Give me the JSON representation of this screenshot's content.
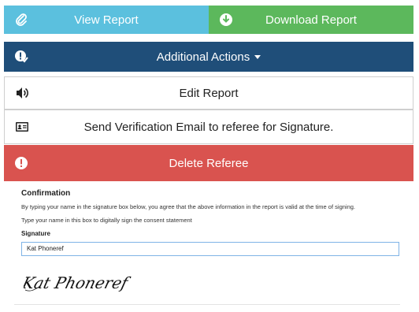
{
  "actions": {
    "view_report": "View Report",
    "download_report": "Download Report",
    "additional_actions": "Additional Actions",
    "edit_report": "Edit Report",
    "send_verification": "Send Verification Email to referee for Signature.",
    "delete_referee": "Delete Referee"
  },
  "confirmation": {
    "heading": "Confirmation",
    "agreement_text": "By typing your name in the signature box below, you agree that the above information in the report is valid at the time of signing.",
    "instruction_text": "Type your name in this box to digitally sign the consent statement",
    "signature_label": "Signature",
    "signature_value": "Kat Phoneref",
    "handwritten_signature": "Kat Phoneref"
  },
  "colors": {
    "view": "#5bc0de",
    "download": "#5cb85c",
    "actions": "#1f4e79",
    "delete": "#d9534f"
  },
  "icons": {
    "view": "paperclip-icon",
    "download": "download-circle-icon",
    "actions": "alert-check-icon",
    "edit": "speaker-icon",
    "verify": "id-card-icon",
    "delete": "exclamation-circle-icon"
  }
}
